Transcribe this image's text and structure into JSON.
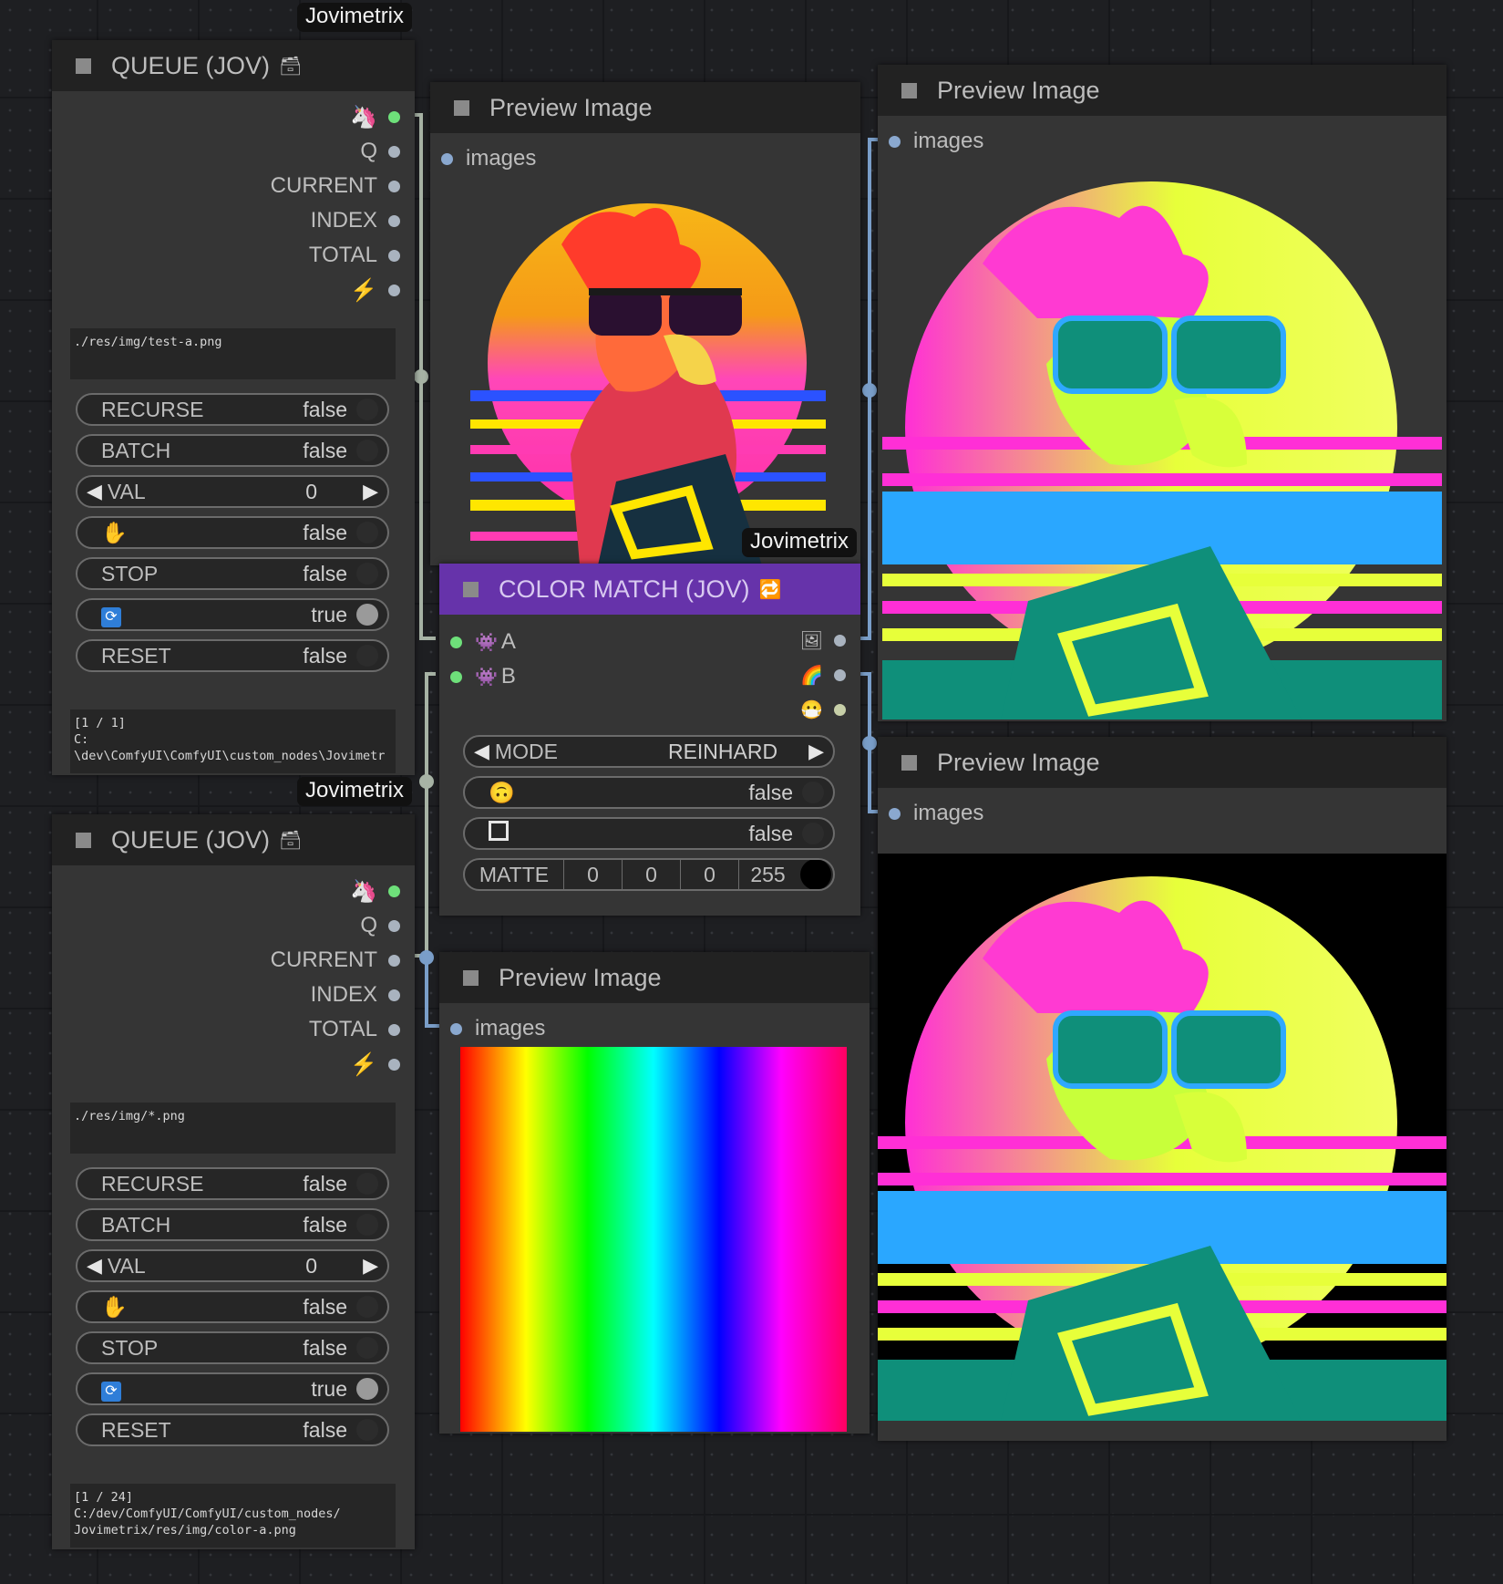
{
  "badges": {
    "b1": "Jovimetrix",
    "b2": "Jovimetrix",
    "b3": "Jovimetrix"
  },
  "queue_nodes": [
    {
      "title": "QUEUE (JOV)",
      "title_emoji": "🗃",
      "outputs": [
        "Q",
        "CURRENT",
        "INDEX",
        "TOTAL"
      ],
      "path": "./res/img/test-a.png",
      "widgets": {
        "recurse": {
          "label": "RECURSE",
          "value": "false"
        },
        "batch": {
          "label": "BATCH",
          "value": "false"
        },
        "val": {
          "label": "VAL",
          "value": "0"
        },
        "hold": {
          "value": "false"
        },
        "stop": {
          "label": "STOP",
          "value": "false"
        },
        "loop": {
          "value": "true"
        },
        "reset": {
          "label": "RESET",
          "value": "false"
        }
      },
      "status": "[1 / 1]\nC:\n\\dev\\ComfyUI\\ComfyUI\\custom_nodes\\Jovimetr"
    },
    {
      "title": "QUEUE (JOV)",
      "title_emoji": "🗃",
      "outputs": [
        "Q",
        "CURRENT",
        "INDEX",
        "TOTAL"
      ],
      "path": "./res/img/*.png",
      "widgets": {
        "recurse": {
          "label": "RECURSE",
          "value": "false"
        },
        "batch": {
          "label": "BATCH",
          "value": "false"
        },
        "val": {
          "label": "VAL",
          "value": "0"
        },
        "hold": {
          "value": "false"
        },
        "stop": {
          "label": "STOP",
          "value": "false"
        },
        "loop": {
          "value": "true"
        },
        "reset": {
          "label": "RESET",
          "value": "false"
        }
      },
      "status": "[1 / 24]\nC:/dev/ComfyUI/ComfyUI/custom_nodes/\nJovimetrix/res/img/color-a.png"
    }
  ],
  "preview_nodes": {
    "p1": {
      "title": "Preview Image",
      "input": "images"
    },
    "p2": {
      "title": "Preview Image",
      "input": "images"
    },
    "p3": {
      "title": "Preview Image",
      "input": "images"
    },
    "p4": {
      "title": "Preview Image",
      "input": "images"
    }
  },
  "color_match": {
    "title": "COLOR MATCH (JOV)",
    "title_emoji": "🔁",
    "inputs": [
      "A",
      "B"
    ],
    "mode": {
      "label": "MODE",
      "value": "REINHARD"
    },
    "flip": {
      "value": "false"
    },
    "invert": {
      "value": "false"
    },
    "matte": {
      "label": "MATTE",
      "r": "0",
      "g": "0",
      "b": "0",
      "a": "255"
    },
    "header_color": "#6633aa"
  }
}
